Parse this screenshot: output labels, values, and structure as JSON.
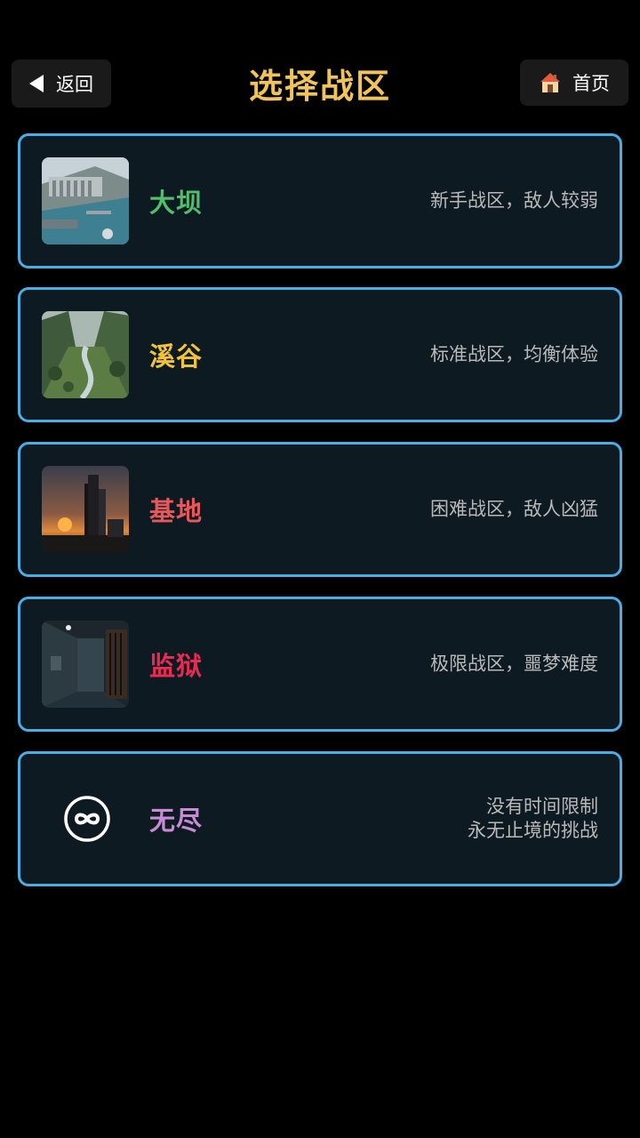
{
  "header": {
    "back_label": "返回",
    "title": "选择战区",
    "home_label": "首页"
  },
  "zones": [
    {
      "name": "大坝",
      "desc": [
        "新手战区，敌人较弱"
      ],
      "color": "#4fbf6a"
    },
    {
      "name": "溪谷",
      "desc": [
        "标准战区，均衡体验"
      ],
      "color": "#f0c23d"
    },
    {
      "name": "基地",
      "desc": [
        "困难战区，敌人凶猛"
      ],
      "color": "#e8585a"
    },
    {
      "name": "监狱",
      "desc": [
        "极限战区，噩梦难度"
      ],
      "color": "#ea2a52"
    },
    {
      "name": "无尽",
      "desc": [
        "没有时间限制",
        "永无止境的挑战"
      ],
      "color": "#c98bd6"
    }
  ],
  "theme": {
    "card_border": "#4aaee6",
    "card_bg": "#0e1a22",
    "title_color": "#f0c45a"
  }
}
